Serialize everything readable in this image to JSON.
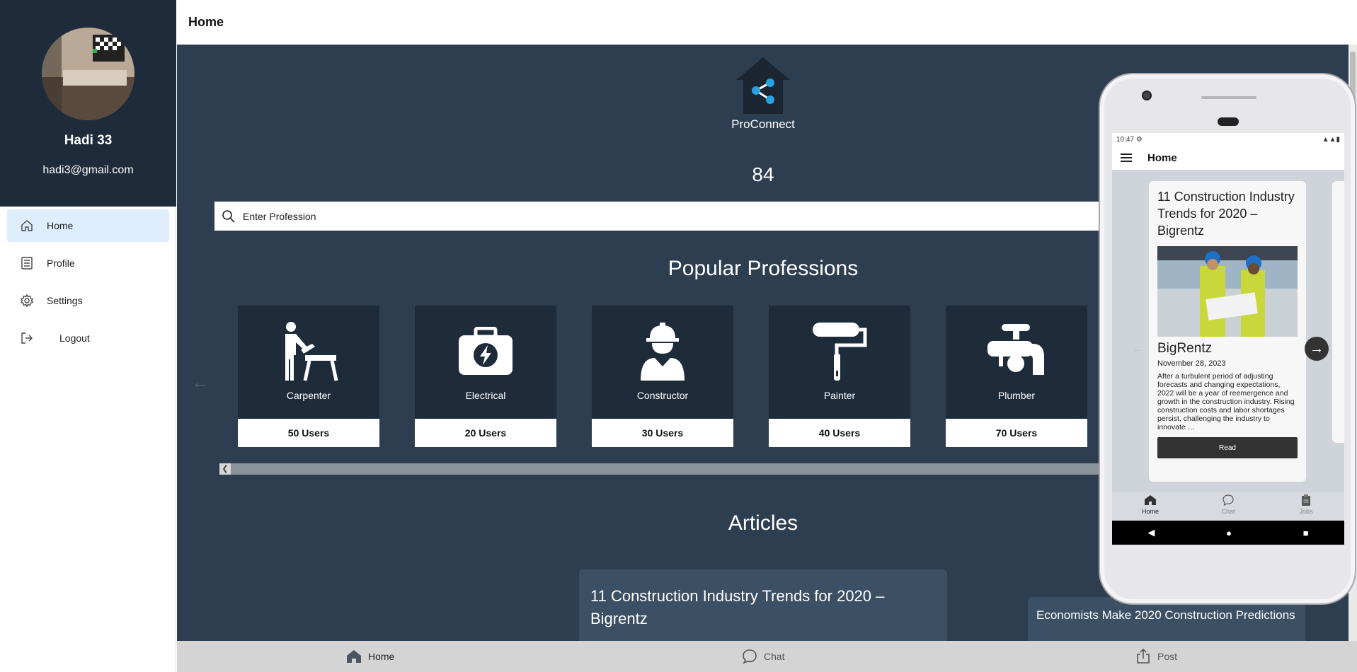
{
  "sidebar": {
    "user_name": "Hadi 33",
    "user_email": "hadi3@gmail.com",
    "items": [
      {
        "label": "Home",
        "icon": "home-icon",
        "active": true
      },
      {
        "label": "Profile",
        "icon": "list-icon",
        "active": false
      },
      {
        "label": "Settings",
        "icon": "gear-icon",
        "active": false
      },
      {
        "label": "Logout",
        "icon": "logout-icon",
        "active": false
      }
    ]
  },
  "topbar": {
    "title": "Home"
  },
  "main": {
    "brand": "ProConnect",
    "count": "84",
    "search_placeholder": "Enter Profession",
    "popular_title": "Popular Professions",
    "professions": [
      {
        "label": "Carpenter",
        "users": "50 Users",
        "icon": "carpenter-icon"
      },
      {
        "label": "Electrical",
        "users": "20 Users",
        "icon": "toolbox-icon"
      },
      {
        "label": "Constructor",
        "users": "30 Users",
        "icon": "worker-icon"
      },
      {
        "label": "Painter",
        "users": "40 Users",
        "icon": "paint-roller-icon"
      },
      {
        "label": "Plumber",
        "users": "70 Users",
        "icon": "faucet-icon"
      }
    ],
    "articles_title": "Articles",
    "articles": [
      {
        "title": "11 Construction Industry Trends for 2020 – Bigrentz"
      },
      {
        "title": "Economists Make 2020 Construction Predictions"
      }
    ]
  },
  "bottombar": {
    "home_label": "Home",
    "chat_label": "Chat",
    "post_label": "Post"
  },
  "phone": {
    "time": "10:47",
    "app_title": "Home",
    "article": {
      "title": "11 Construction Industry Trends for 2020 – Bigrentz",
      "source": "BigRentz",
      "date": "November 28, 2023",
      "body": "After a turbulent period of adjusting forecasts and changing expectations, 2022 will be a year of reemergence and growth in the construction industry. Rising construction costs and labor shortages persist, challenging the industry to innovate …",
      "read_label": "Read"
    },
    "tabs": {
      "home": "Home",
      "chat": "Chat",
      "jobs": "Jobs"
    }
  },
  "colors": {
    "sidebar_header": "#1e2b3a",
    "main_bg": "#2e3e51",
    "card_bg": "#1e2b3a",
    "active_nav": "#deeeff"
  }
}
